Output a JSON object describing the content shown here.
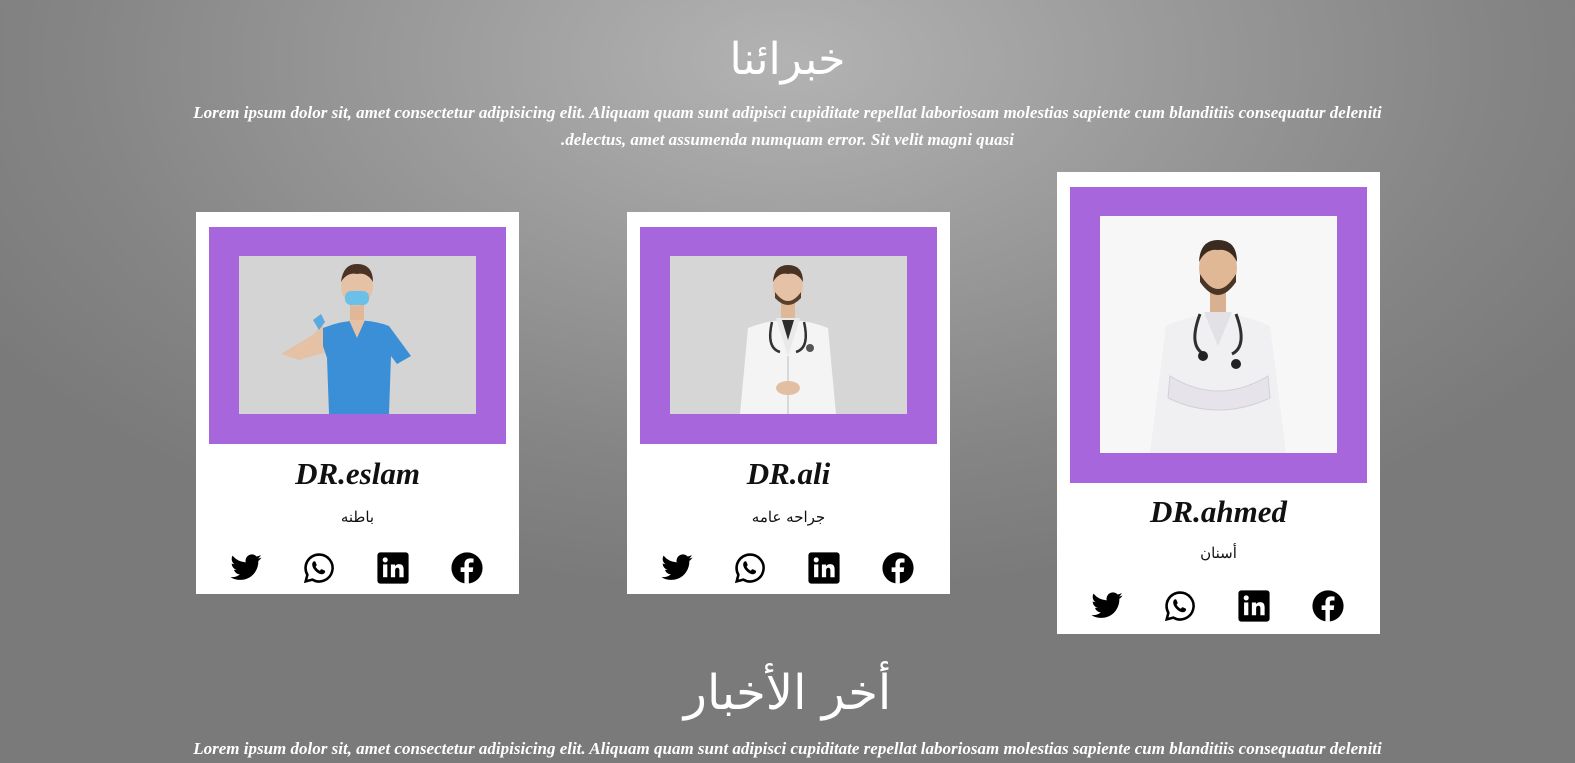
{
  "experts": {
    "title": "خبرائنا",
    "description_line1": "Lorem ipsum dolor sit, amet consectetur adipisicing elit. Aliquam quam sunt adipisci cupiditate repellat laboriosam molestias sapiente cum blanditiis consequatur deleniti",
    "description_line2": ".delectus, amet assumenda numquam error. Sit velit magni quasi"
  },
  "cards": [
    {
      "name": "DR.eslam",
      "specialty": "باطنه",
      "photo": "doctor-thumbs-up-scrubs"
    },
    {
      "name": "DR.ali",
      "specialty": "جراحه عامه",
      "photo": "doctor-white-coat-stethoscope"
    },
    {
      "name": "DR.ahmed",
      "specialty": "أسنان",
      "photo": "doctor-arms-crossed"
    }
  ],
  "socials": [
    "twitter-icon",
    "whatsapp-icon",
    "linkedin-icon",
    "facebook-icon"
  ],
  "news": {
    "title": "أخر الأخبار",
    "description_line1": "Lorem ipsum dolor sit, amet consectetur adipisicing elit. Aliquam quam sunt adipisci cupiditate repellat laboriosam molestias sapiente cum blanditiis consequatur deleniti"
  },
  "colors": {
    "accent": "#a866dc",
    "card_background": "#ffffff",
    "text_dark": "#111111"
  }
}
